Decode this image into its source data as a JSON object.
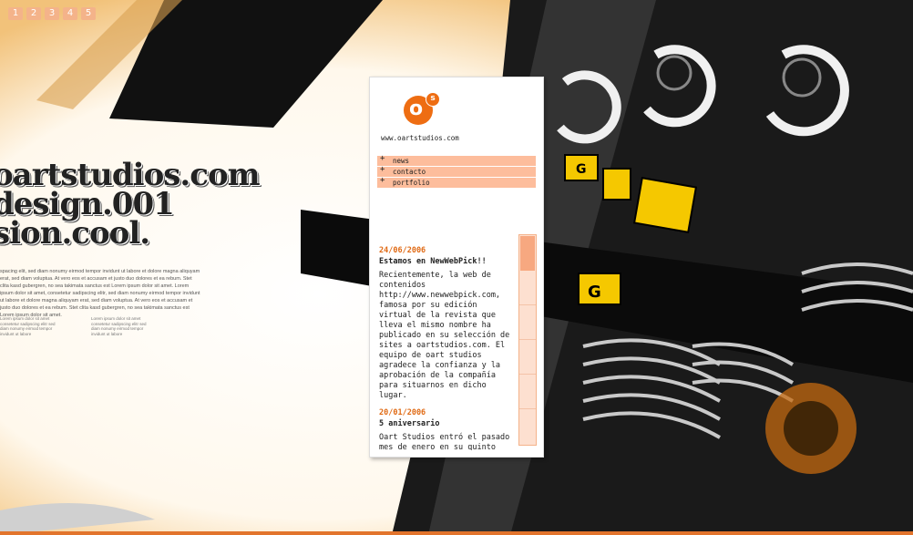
{
  "pager": [
    "1",
    "2",
    "3",
    "4",
    "5"
  ],
  "headline": [
    "oartstudios.com",
    "design.001",
    "sion.cool."
  ],
  "lorem": "spacing elit, sed diam nonumy eirmod tempor invidunt ut labore et dolore magna aliquyam erat, sed diam voluptua. At vero eos et accusam et justo duo dolores et ea rebum. Stet clita kasd gubergren, no sea takimata sanctus est Lorem ipsum dolor sit amet. Lorem ipsum dolor sit amet, consetetur sadipscing elitr, sed diam nonumy eirmod tempor invidunt ut labore et dolore magna aliquyam erat, sed diam voluptua. At vero eos et accusam et justo duo dolores et ea rebum. Stet clita kasd gubergren, no sea takimata sanctus est Lorem ipsum dolor sit amet.",
  "lorem_cols": [
    "Lorem ipsum dolor sit amet consetetur sadipscing elitr sed diam nonumy eirmod tempor invidunt ut labore",
    "Lorem ipsum dolor sit amet consetetur sadipscing elitr sed diam nonumy eirmod tempor invidunt ut labore"
  ],
  "panel": {
    "logo_letter": "o",
    "logo_sup": "s",
    "site_url": "www.oartstudios.com",
    "nav": [
      {
        "plus": "+",
        "label": "news"
      },
      {
        "plus": "+",
        "label": "contacto"
      },
      {
        "plus": "+",
        "label": "portfolio"
      }
    ],
    "news": [
      {
        "date": "24/06/2006",
        "title": "Estamos en NewWebPick!!",
        "body": "Recientemente, la web de contenidos http://www.newwebpick.com, famosa por su edición virtual de la revista que lleva el mismo nombre ha publicado en su selección de sites a oartstudios.com. El equipo de oart studios agradece la confianza y la aprobación de la compañía para situarnos en dicho lugar."
      },
      {
        "date": "20/01/2006",
        "title": "5 aniversario",
        "body": "Oart Studios entró el pasado mes de enero en su quinto año de vida. Esperamos seguir"
      }
    ]
  },
  "colors": {
    "accent": "#ee6d12",
    "nav_bg": "#fdbd9c",
    "date": "#e06a14"
  }
}
